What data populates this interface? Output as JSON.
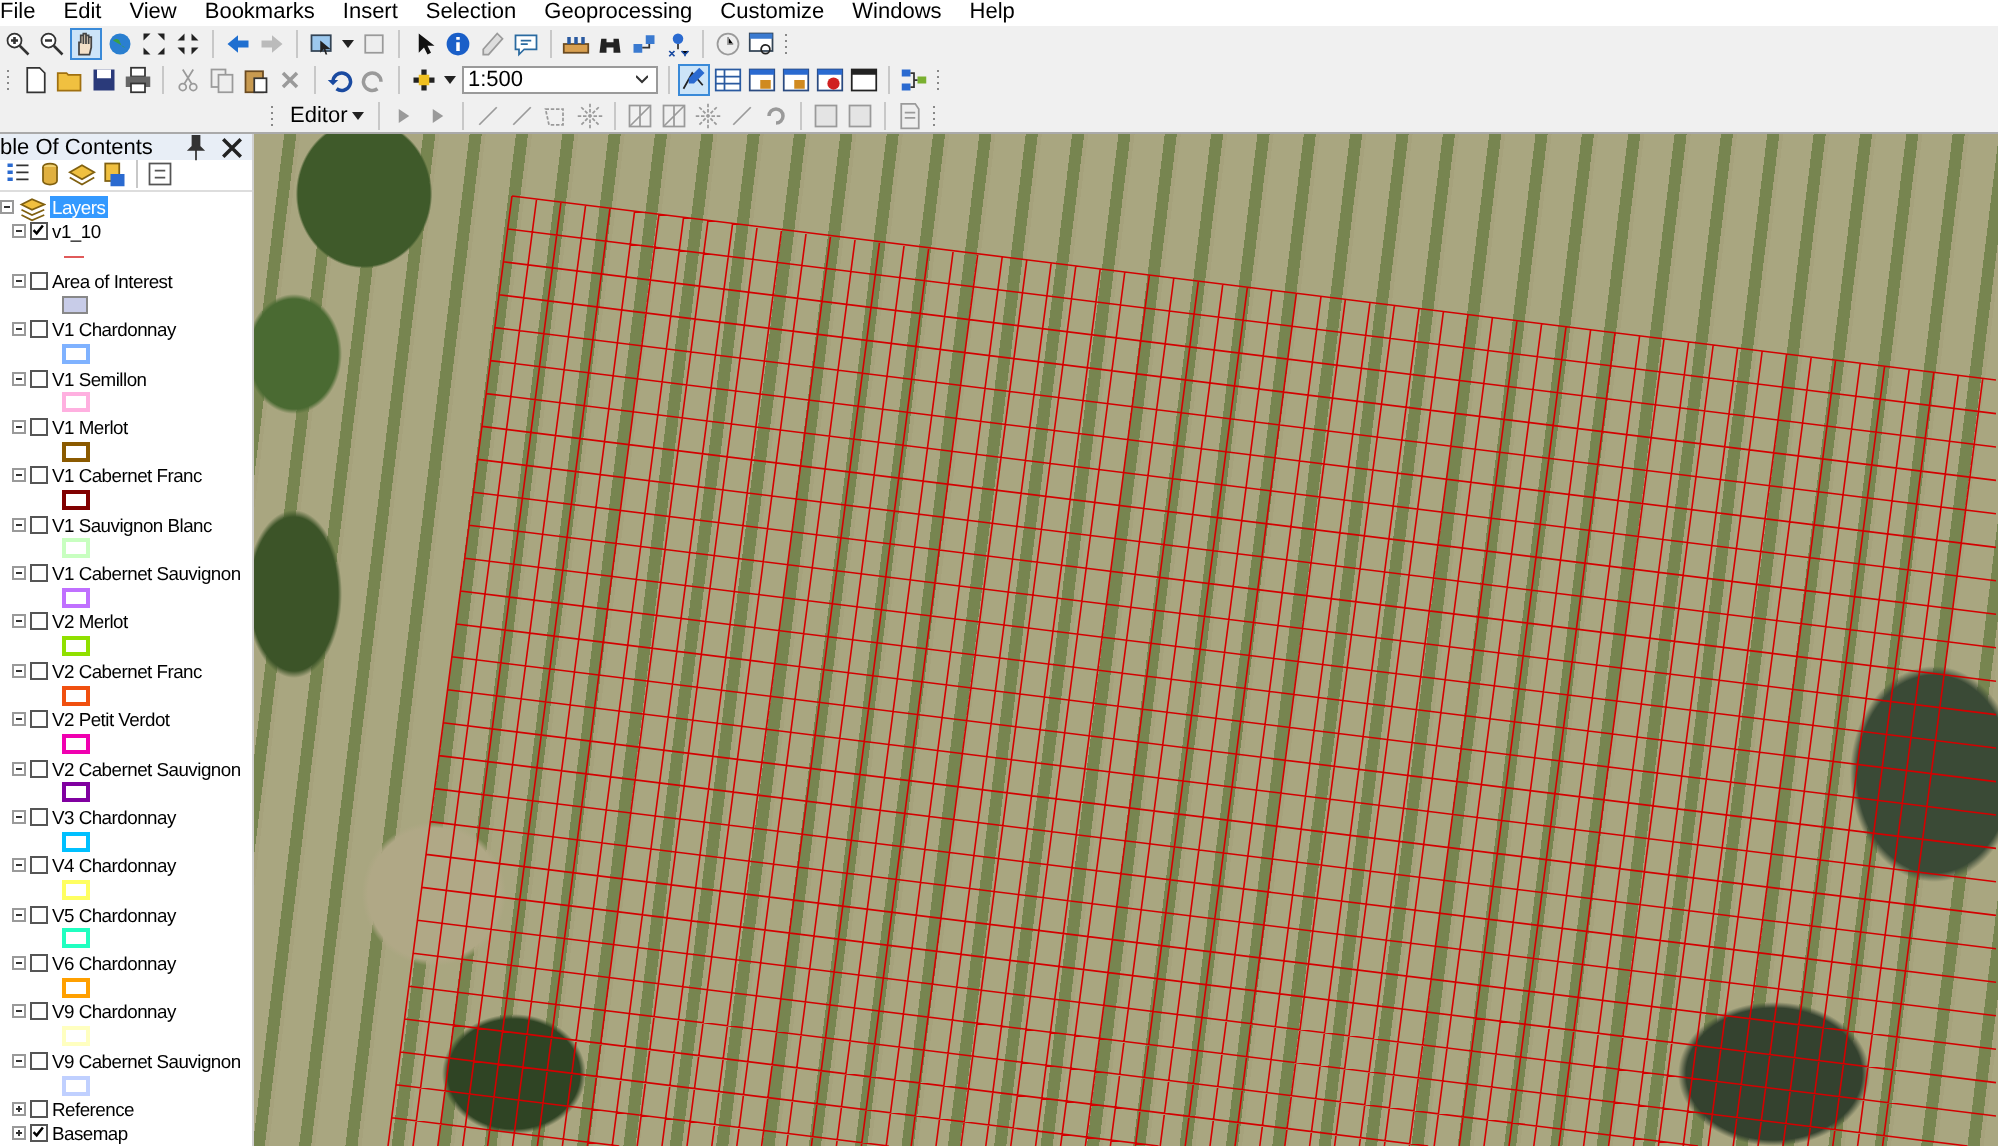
{
  "menu": [
    "File",
    "Edit",
    "View",
    "Bookmarks",
    "Insert",
    "Selection",
    "Geoprocessing",
    "Customize",
    "Windows",
    "Help"
  ],
  "toolbar": {
    "scale": "1:500",
    "editor_menu": "Editor"
  },
  "toc": {
    "title": "ble Of Contents",
    "root": {
      "label": "Layers",
      "selected": true,
      "expanded": true,
      "children": [
        {
          "label": "v1_10",
          "checked": true,
          "expanded": true,
          "symbol": {
            "kind": "line",
            "color": "#e05a5a"
          }
        },
        {
          "label": "Area of Interest",
          "checked": false,
          "expanded": true,
          "symbol": {
            "kind": "filled",
            "color": "#c8cce8"
          }
        },
        {
          "label": "V1 Chardonnay",
          "checked": false,
          "expanded": true,
          "symbol": {
            "kind": "outline",
            "color": "#7fb2ff"
          }
        },
        {
          "label": "V1 Semillon",
          "checked": false,
          "expanded": true,
          "symbol": {
            "kind": "outline",
            "color": "#ffb0e0"
          }
        },
        {
          "label": "V1 Merlot",
          "checked": false,
          "expanded": true,
          "symbol": {
            "kind": "outline",
            "color": "#8b5a00"
          }
        },
        {
          "label": "V1 Cabernet Franc",
          "checked": false,
          "expanded": true,
          "symbol": {
            "kind": "outline",
            "color": "#800000"
          }
        },
        {
          "label": "V1 Sauvignon Blanc",
          "checked": false,
          "expanded": true,
          "symbol": {
            "kind": "outline",
            "color": "#c8ffc0"
          }
        },
        {
          "label": "V1 Cabernet Sauvignon",
          "checked": false,
          "expanded": true,
          "symbol": {
            "kind": "outline",
            "color": "#c070ff"
          }
        },
        {
          "label": "V2 Merlot",
          "checked": false,
          "expanded": true,
          "symbol": {
            "kind": "outline",
            "color": "#90e000"
          }
        },
        {
          "label": "V2 Cabernet Franc",
          "checked": false,
          "expanded": true,
          "symbol": {
            "kind": "outline",
            "color": "#f05010"
          }
        },
        {
          "label": "V2 Petit Verdot",
          "checked": false,
          "expanded": true,
          "symbol": {
            "kind": "outline",
            "color": "#f000b0"
          }
        },
        {
          "label": "V2 Cabernet Sauvignon",
          "checked": false,
          "expanded": true,
          "symbol": {
            "kind": "outline",
            "color": "#8000a0"
          }
        },
        {
          "label": "V3 Chardonnay",
          "checked": false,
          "expanded": true,
          "symbol": {
            "kind": "outline",
            "color": "#00c0ff"
          }
        },
        {
          "label": "V4 Chardonnay",
          "checked": false,
          "expanded": true,
          "symbol": {
            "kind": "outline",
            "color": "#ffff60"
          }
        },
        {
          "label": "V5 Chardonnay",
          "checked": false,
          "expanded": true,
          "symbol": {
            "kind": "outline",
            "color": "#20ffc0"
          }
        },
        {
          "label": "V6 Chardonnay",
          "checked": false,
          "expanded": true,
          "symbol": {
            "kind": "outline",
            "color": "#ffa000"
          }
        },
        {
          "label": "V9 Chardonnay",
          "checked": false,
          "expanded": true,
          "symbol": {
            "kind": "outline",
            "color": "#ffffc0"
          }
        },
        {
          "label": "V9 Cabernet Sauvignon",
          "checked": false,
          "expanded": true,
          "symbol": {
            "kind": "outline",
            "color": "#c0d0ff"
          }
        },
        {
          "label": "Reference",
          "checked": false,
          "expanded": false
        },
        {
          "label": "Basemap",
          "checked": true,
          "expanded": false
        }
      ]
    }
  }
}
